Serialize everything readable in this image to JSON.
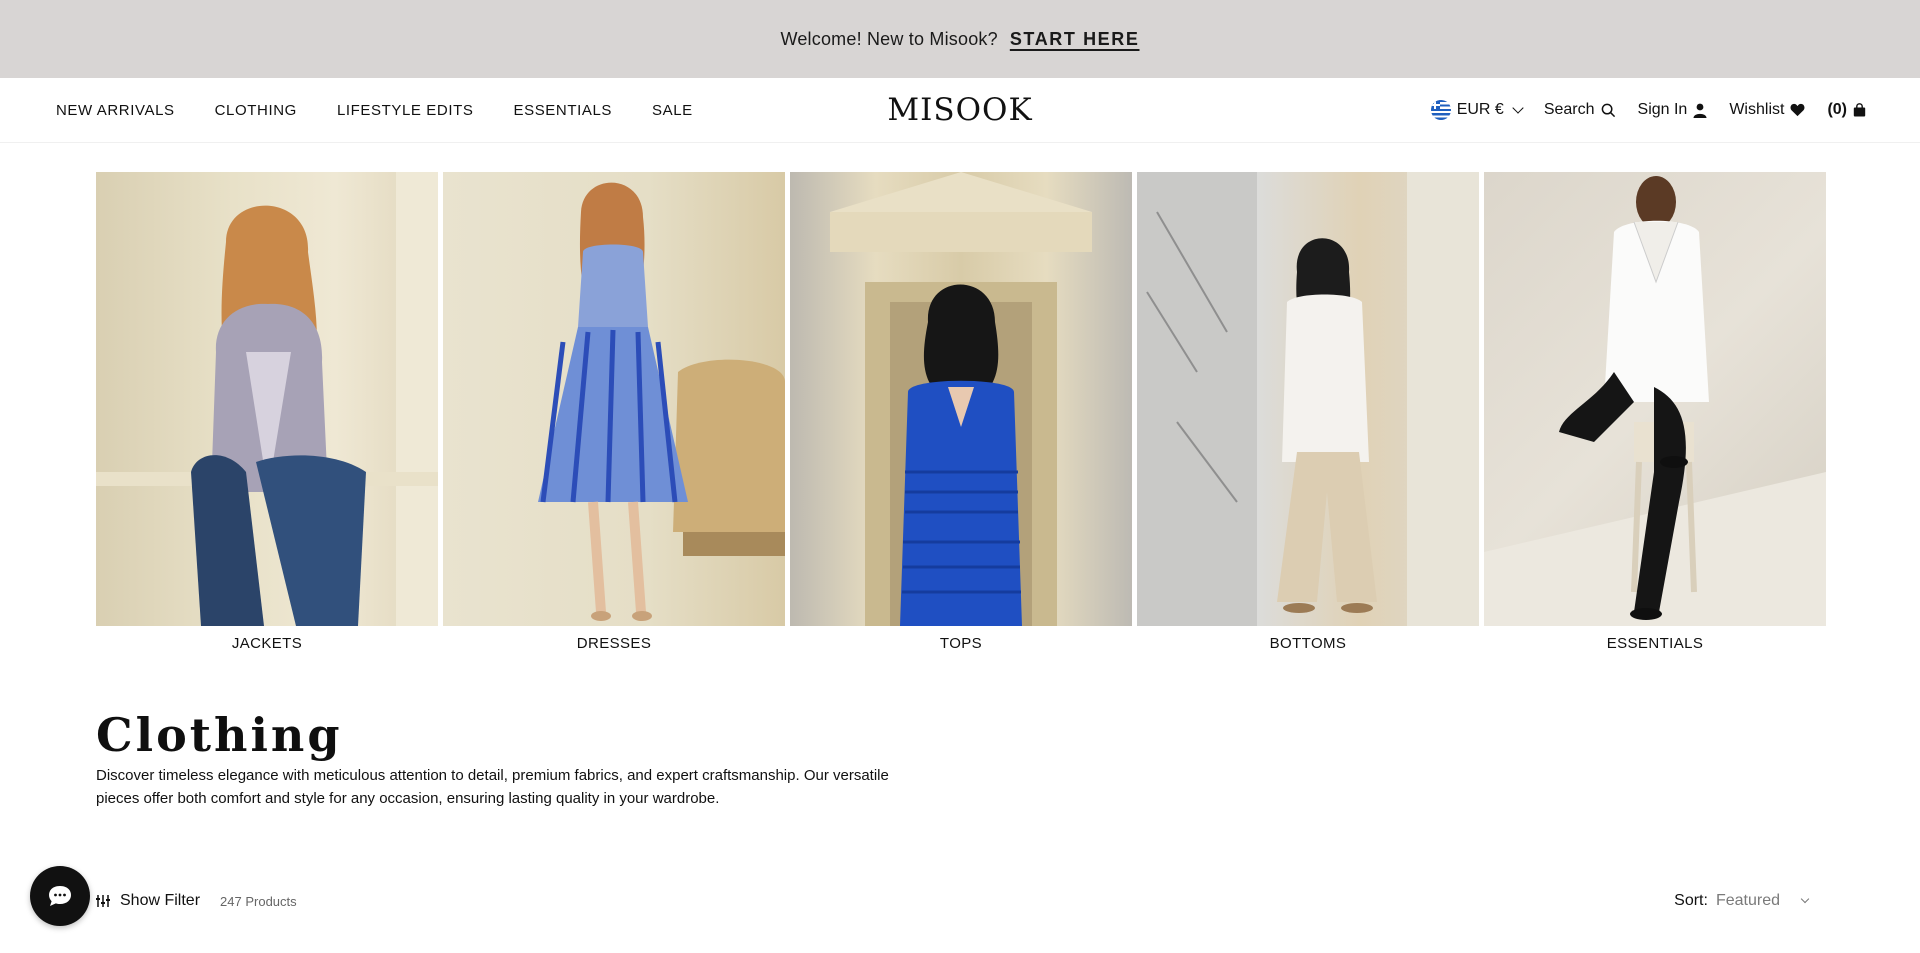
{
  "announcement": {
    "text": "Welcome! New to Misook?",
    "link": "START HERE"
  },
  "nav": {
    "items": [
      {
        "label": "NEW ARRIVALS"
      },
      {
        "label": "CLOTHING"
      },
      {
        "label": "LIFESTYLE EDITS"
      },
      {
        "label": "ESSENTIALS"
      },
      {
        "label": "SALE"
      }
    ]
  },
  "logo": "MISOOK",
  "utility": {
    "currency": "EUR €",
    "search": "Search",
    "sign_in": "Sign In",
    "wishlist": "Wishlist",
    "cart": "(0)"
  },
  "categories": [
    {
      "label": "JACKETS"
    },
    {
      "label": "DRESSES"
    },
    {
      "label": "TOPS"
    },
    {
      "label": "BOTTOMS"
    },
    {
      "label": "ESSENTIALS"
    }
  ],
  "page": {
    "title": "Clothing",
    "description": "Discover timeless elegance with meticulous attention to detail, premium fabrics, and expert craftsmanship. Our versatile pieces offer both comfort and style for any occasion, ensuring lasting quality in your wardrobe."
  },
  "filter": {
    "label": "Show Filter",
    "count": "247 Products"
  },
  "sort": {
    "label": "Sort:",
    "value": "Featured"
  },
  "colors": {
    "announcement_bg": "#d8d5d4",
    "text": "#111111"
  }
}
